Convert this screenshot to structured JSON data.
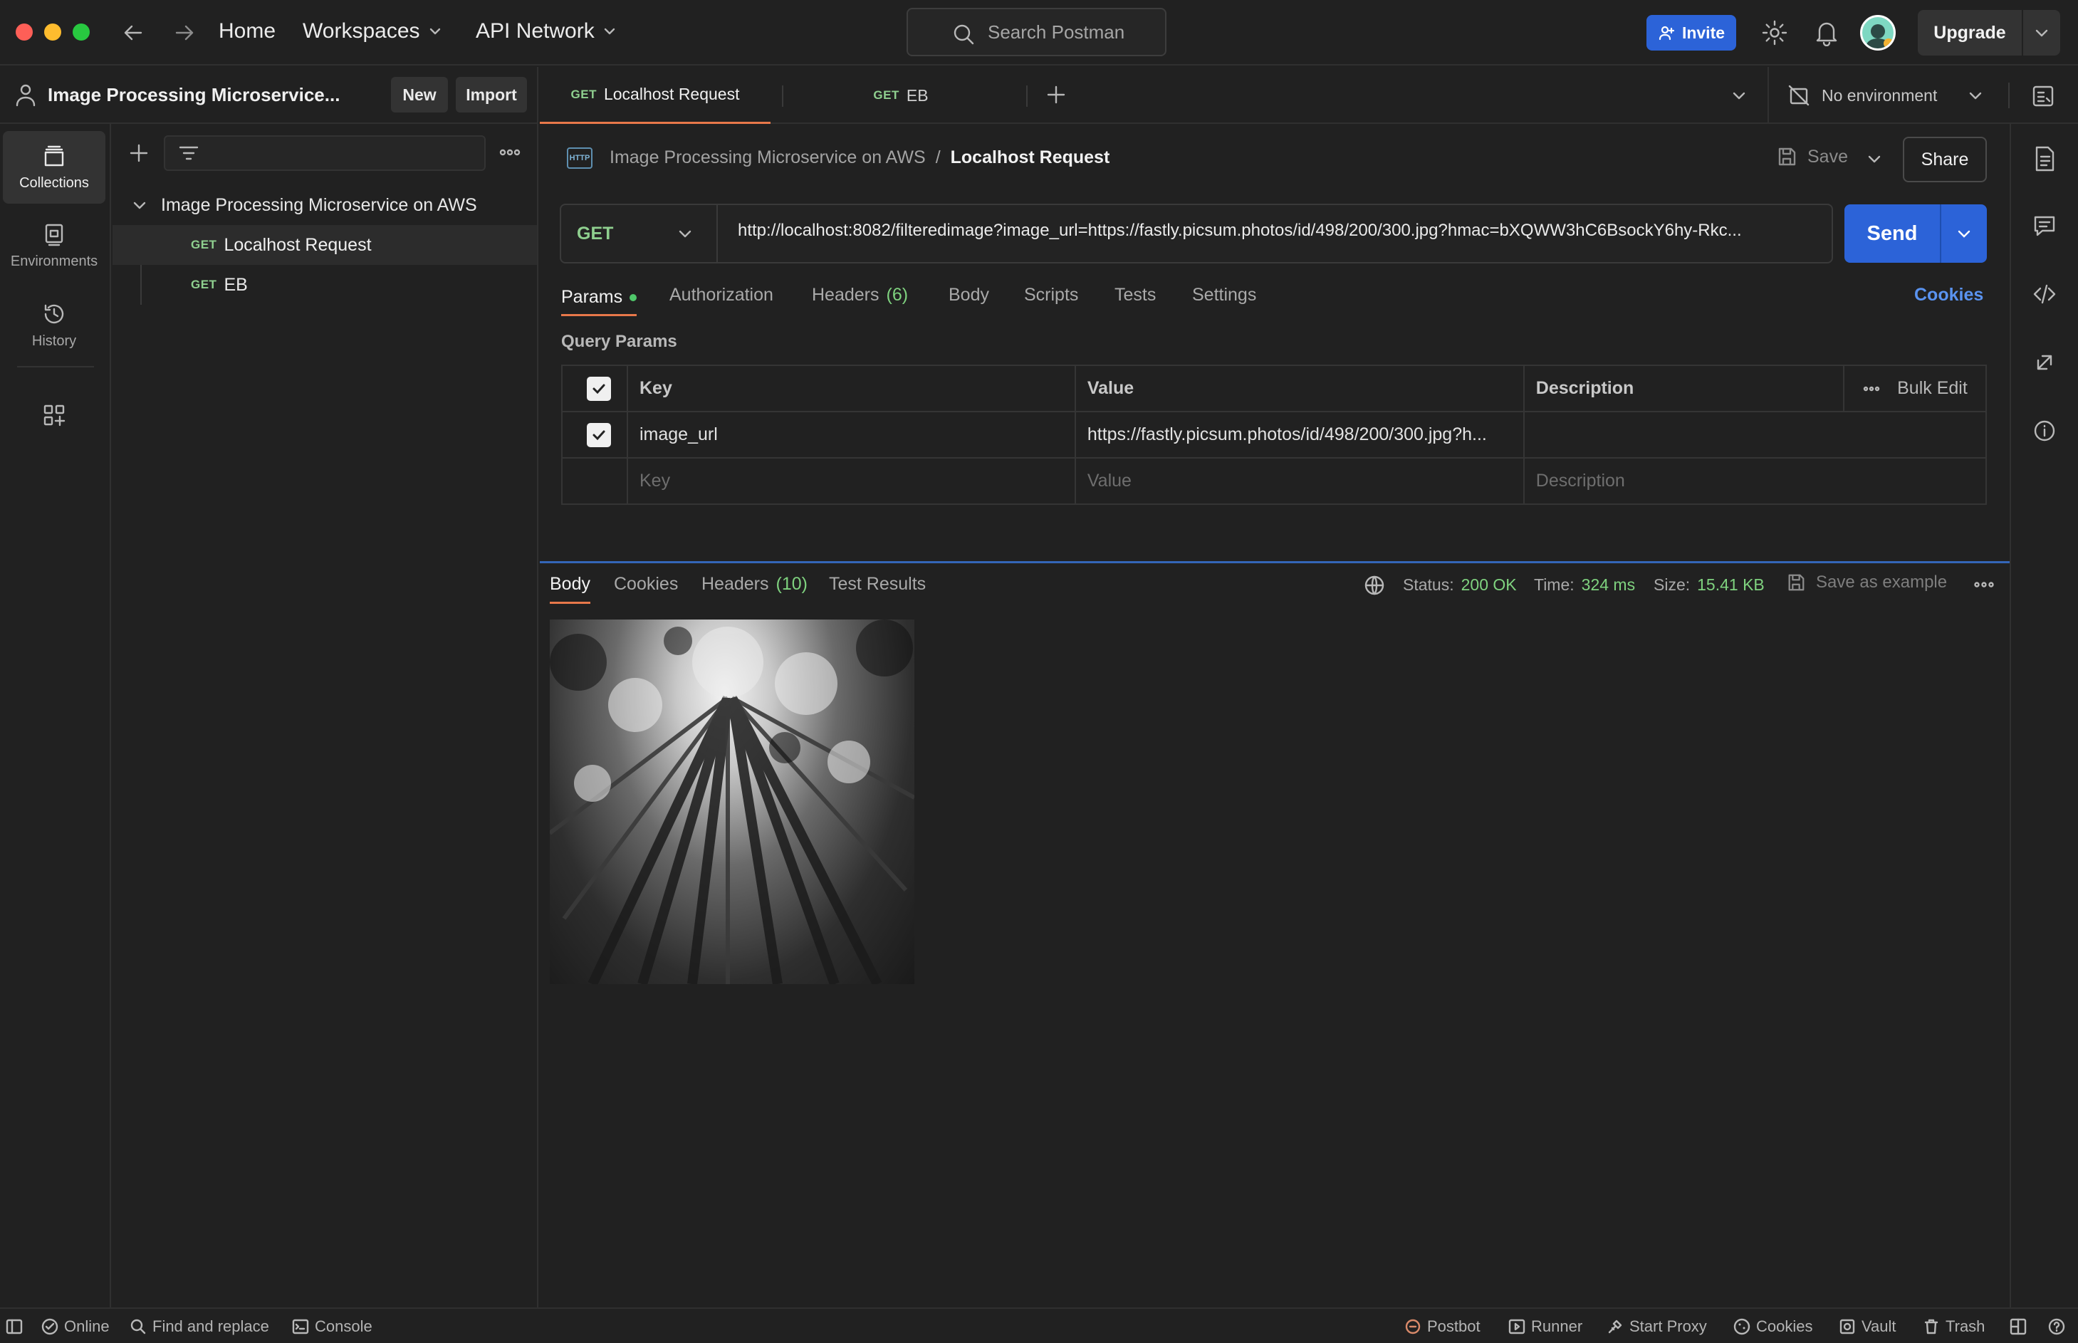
{
  "colors": {
    "accent": "#2c63d8",
    "method_get": "#8fd08f",
    "status_ok": "#7fd27f",
    "tab_underline": "#e8784a",
    "link": "#5a93f0"
  },
  "nav": {
    "home": "Home",
    "workspaces": "Workspaces",
    "api_network": "API Network"
  },
  "search": {
    "placeholder": "Search Postman"
  },
  "header": {
    "invite": "Invite",
    "upgrade": "Upgrade"
  },
  "workspace": {
    "name": "Image Processing Microservice...",
    "new": "New",
    "import": "Import"
  },
  "tabs": [
    {
      "method": "GET",
      "label": "Localhost Request"
    },
    {
      "method": "GET",
      "label": "EB"
    }
  ],
  "environment": {
    "label": "No environment"
  },
  "rail": {
    "collections": "Collections",
    "environments": "Environments",
    "history": "History"
  },
  "sidebar": {
    "collection": "Image Processing Microservice on AWS",
    "items": [
      {
        "method": "GET",
        "label": "Localhost Request"
      },
      {
        "method": "GET",
        "label": "EB"
      }
    ]
  },
  "request": {
    "breadcrumb_collection": "Image Processing Microservice on AWS",
    "breadcrumb_sep": "/",
    "breadcrumb_request": "Localhost Request",
    "save": "Save",
    "share": "Share",
    "method": "GET",
    "url": "http://localhost:8082/filteredimage?image_url=https://fastly.picsum.photos/id/498/200/300.jpg?hmac=bXQWW3hC6BsockY6hy-Rkc...",
    "send": "Send",
    "tabs": {
      "params": "Params",
      "authorization": "Authorization",
      "headers": "Headers",
      "headers_count": "(6)",
      "body": "Body",
      "scripts": "Scripts",
      "tests": "Tests",
      "settings": "Settings",
      "cookies": "Cookies"
    },
    "query_params_title": "Query Params",
    "table": {
      "headers": {
        "key": "Key",
        "value": "Value",
        "description": "Description",
        "bulk_edit": "Bulk Edit"
      },
      "rows": [
        {
          "key": "image_url",
          "value": "https://fastly.picsum.photos/id/498/200/300.jpg?h...",
          "description": ""
        }
      ],
      "placeholder": {
        "key": "Key",
        "value": "Value",
        "description": "Description"
      }
    }
  },
  "response": {
    "tabs": {
      "body": "Body",
      "cookies": "Cookies",
      "headers": "Headers",
      "headers_count": "(10)",
      "test_results": "Test Results"
    },
    "status_label": "Status:",
    "status_value": "200 OK",
    "time_label": "Time:",
    "time_value": "324 ms",
    "size_label": "Size:",
    "size_value": "15.41 KB",
    "save_example": "Save as example"
  },
  "footer": {
    "online": "Online",
    "find_replace": "Find and replace",
    "console": "Console",
    "postbot": "Postbot",
    "runner": "Runner",
    "start_proxy": "Start Proxy",
    "cookies": "Cookies",
    "vault": "Vault",
    "trash": "Trash"
  }
}
